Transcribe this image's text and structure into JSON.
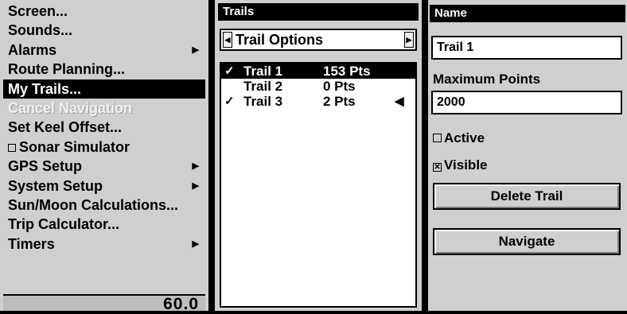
{
  "menu": {
    "items": [
      {
        "label": "Screen...",
        "arrow": ""
      },
      {
        "label": "Sounds...",
        "arrow": ""
      },
      {
        "label": "Alarms",
        "arrow": "▶"
      },
      {
        "label": "Route Planning...",
        "arrow": ""
      },
      {
        "label": "My Trails...",
        "arrow": ""
      },
      {
        "label": "Cancel Navigation",
        "arrow": ""
      },
      {
        "label": "Set Keel Offset...",
        "arrow": ""
      },
      {
        "label": "Sonar Simulator",
        "arrow": ""
      },
      {
        "label": "GPS Setup",
        "arrow": "▶"
      },
      {
        "label": "System Setup",
        "arrow": "▶"
      },
      {
        "label": "Sun/Moon Calculations...",
        "arrow": ""
      },
      {
        "label": "Trip Calculator...",
        "arrow": ""
      },
      {
        "label": "Timers",
        "arrow": "▶"
      }
    ],
    "selected": "My Trails...",
    "disabled": "Cancel Navigation",
    "status_value": "60.0"
  },
  "trails": {
    "title": "Trails",
    "option_label": "Trail Options",
    "rows": [
      {
        "check": "✓",
        "name": "Trail 1",
        "points": "153 Pts",
        "marker": ""
      },
      {
        "check": "",
        "name": "Trail 2",
        "points": "0 Pts",
        "marker": ""
      },
      {
        "check": "✓",
        "name": "Trail 3",
        "points": "2 Pts",
        "marker": "◀"
      }
    ]
  },
  "detail": {
    "name_label": "Name",
    "name_value": "Trail 1",
    "max_points_label": "Maximum Points",
    "max_points_value": "2000",
    "active_label": "Active",
    "active_checked": false,
    "visible_label": "Visible",
    "visible_checked": true,
    "delete_button": "Delete Trail",
    "navigate_button": "Navigate"
  }
}
